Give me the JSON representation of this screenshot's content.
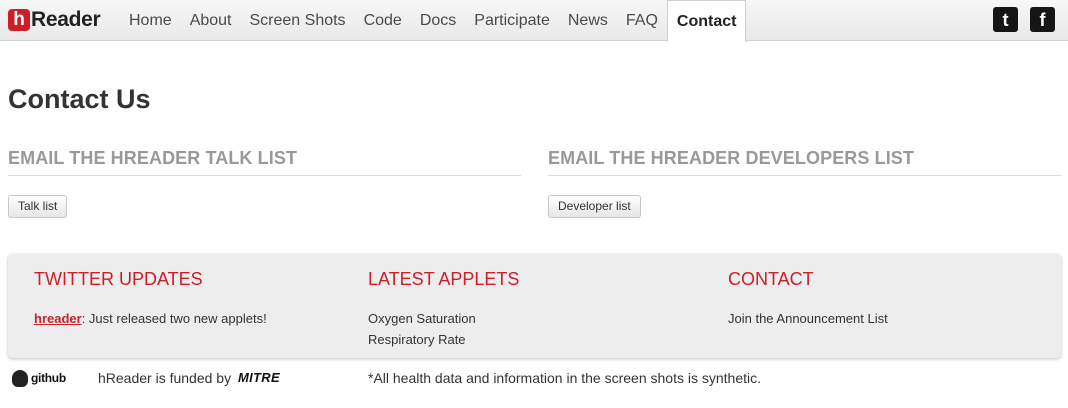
{
  "brand": {
    "badge": "h",
    "name": "Reader"
  },
  "nav": {
    "items": [
      {
        "label": "Home"
      },
      {
        "label": "About"
      },
      {
        "label": "Screen Shots"
      },
      {
        "label": "Code"
      },
      {
        "label": "Docs"
      },
      {
        "label": "Participate"
      },
      {
        "label": "News"
      },
      {
        "label": "FAQ"
      },
      {
        "label": "Contact",
        "active": true
      }
    ],
    "social": [
      {
        "icon": "twitter-icon",
        "glyph": "t"
      },
      {
        "icon": "facebook-icon",
        "glyph": "f"
      }
    ]
  },
  "main": {
    "title": "Contact Us",
    "sections": [
      {
        "heading": "Email the hReader Talk List",
        "button": "Talk list"
      },
      {
        "heading": "Email the hReader Developers List",
        "button": "Developer list"
      }
    ]
  },
  "footer": {
    "twitter": {
      "heading": "Twitter Updates",
      "handle": "hreader",
      "tweet": ": Just released two new applets!"
    },
    "applets": {
      "heading": "Latest Applets",
      "items": [
        "Oxygen Saturation",
        "Respiratory Rate"
      ]
    },
    "contact": {
      "heading": "Contact",
      "link": "Join the Announcement List"
    }
  },
  "bottom": {
    "github": "github",
    "funded_text": "hReader is funded by",
    "sponsor": "MITRE",
    "disclaimer": "*All health data and information in the screen shots is synthetic."
  },
  "colors": {
    "accent": "#cc1f27",
    "heading_gray": "#999999"
  }
}
